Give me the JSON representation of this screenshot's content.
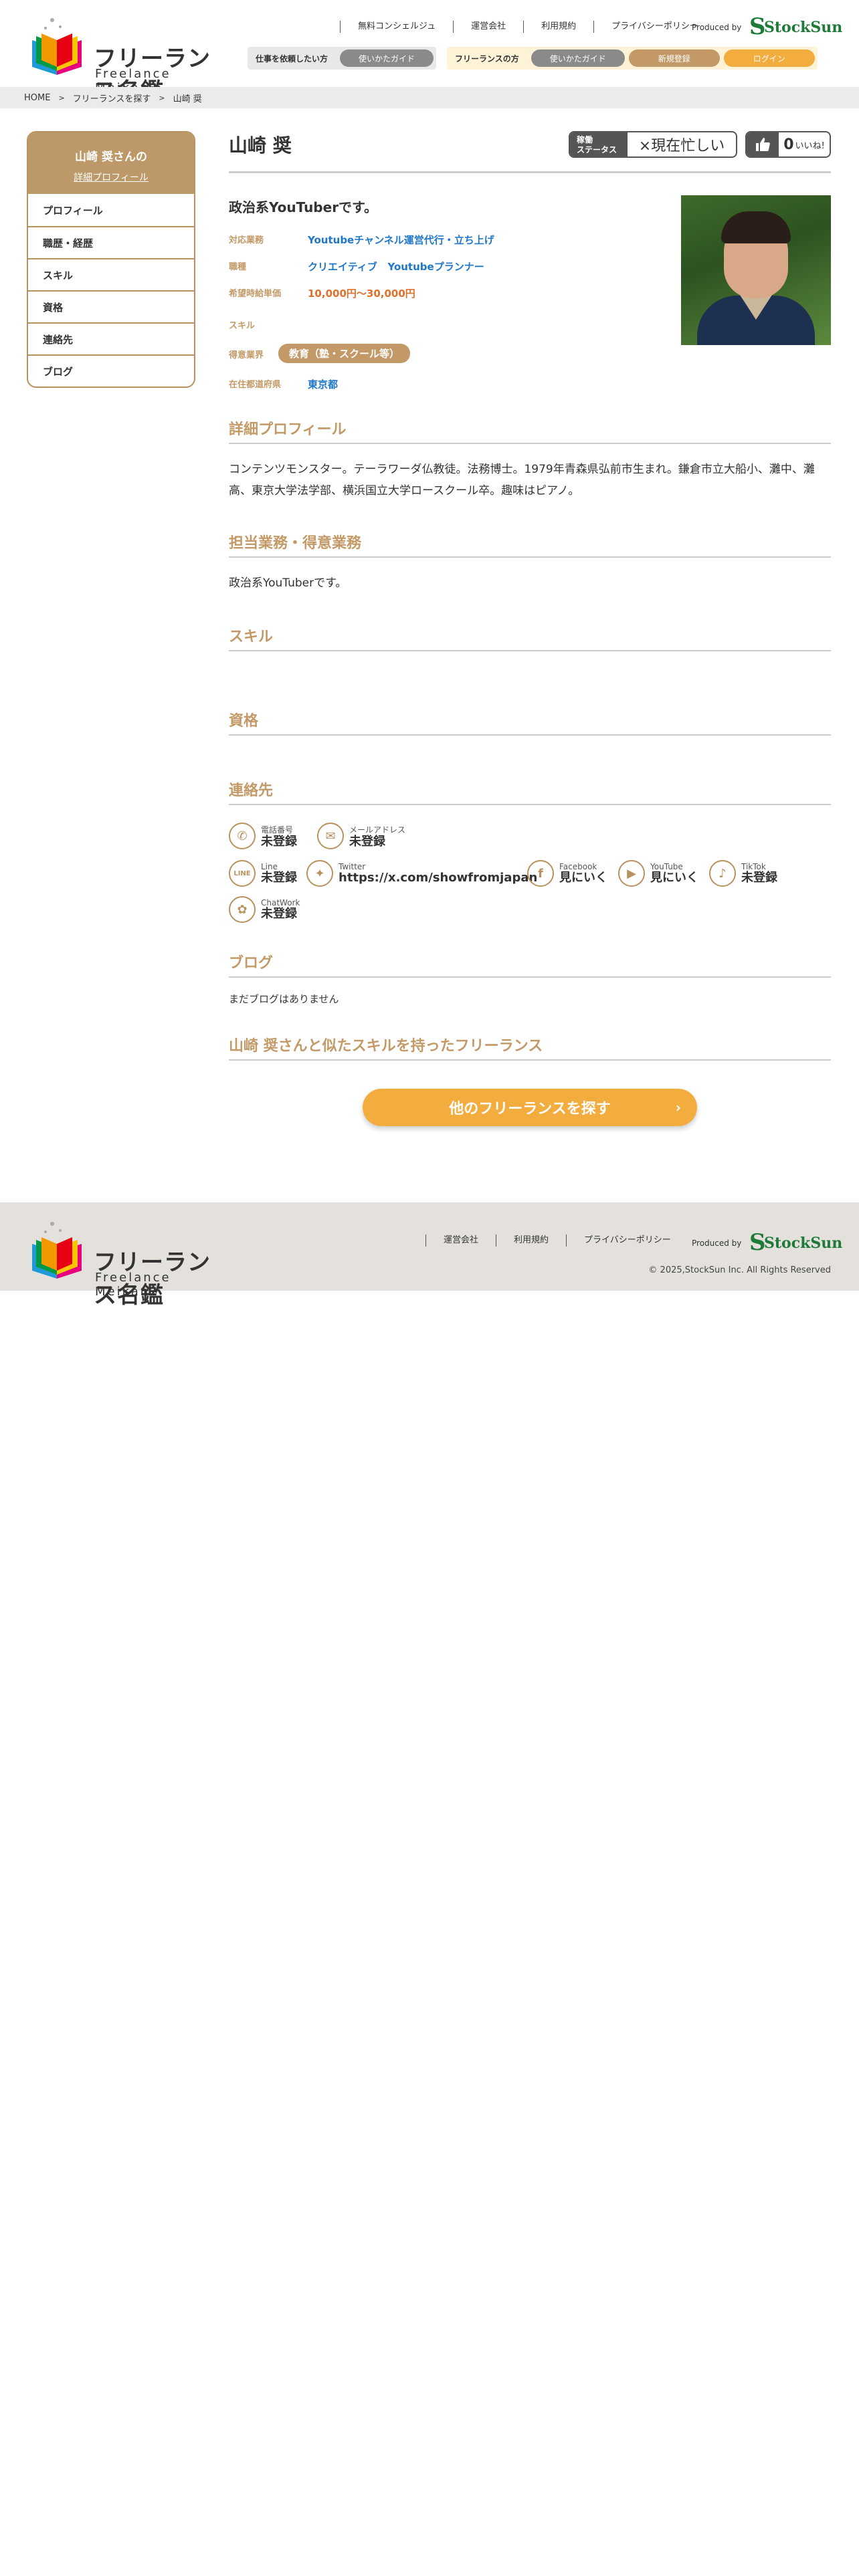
{
  "header": {
    "logo_jp": "フリーランス名鑑",
    "logo_en": "Freelance Meikan",
    "nav": [
      "無料コンシェルジュ",
      "運営会社",
      "利用規約",
      "プライバシーポリシー"
    ],
    "produced_by": "Produced by",
    "brand": "StockSun",
    "client_group_label": "仕事を依頼したい方",
    "client_guide": "使いかたガイド",
    "freelance_group_label": "フリーランスの方",
    "freelance_guide": "使いかたガイド",
    "register": "新規登録",
    "login": "ログイン"
  },
  "breadcrumb": [
    "HOME",
    "フリーランスを探す",
    "山崎 奨"
  ],
  "sidebar": {
    "title": "山崎 奨さんの",
    "subtitle": "詳細プロフィール",
    "items": [
      "プロフィール",
      "職歴・経歴",
      "スキル",
      "資格",
      "連絡先",
      "ブログ"
    ]
  },
  "profile": {
    "name": "山崎 奨",
    "status_label_1": "稼働",
    "status_label_2": "ステータス",
    "status_value": "×現在忙しい",
    "likes_count": "0",
    "likes_label": "いいね!",
    "catchphrase": "政治系YouTuberです。",
    "fields": {
      "services_label": "対応業務",
      "services_value": "Youtubeチャンネル運営代行・立ち上げ",
      "job_label": "職種",
      "job_value": "クリエイティブ   Youtubeプランナー",
      "rate_label": "希望時給単価",
      "rate_value": "10,000円〜30,000円",
      "skill_label": "スキル",
      "industry_label": "得意業界",
      "industry_value": "教育（塾・スクール等）",
      "pref_label": "在住都道府県",
      "pref_value": "東京都"
    }
  },
  "sections": {
    "detail_title": "詳細プロフィール",
    "detail_text": "コンテンツモンスター。テーラワーダ仏教徒。法務博士。1979年青森県弘前市生まれ。鎌倉市立大船小、灘中、灘高、東京大学法学部、横浜国立大学ロースクール卒。趣味はピアノ。",
    "work_title": "担当業務・得意業務",
    "work_text": "政治系YouTuberです。",
    "skill_title": "スキル",
    "cert_title": "資格",
    "contact_title": "連絡先",
    "blog_title": "ブログ",
    "blog_text": "まだブログはありません",
    "similar_title": "山崎 奨さんと似たスキルを持ったフリーランス",
    "cta": "他のフリーランスを探す"
  },
  "contacts": [
    {
      "label": "電話番号",
      "value": "未登録",
      "icon": "phone-icon"
    },
    {
      "label": "メールアドレス",
      "value": "未登録",
      "icon": "mail-icon"
    },
    {
      "label": "Line",
      "value": "未登録",
      "icon": "line-icon"
    },
    {
      "label": "Twitter",
      "value": "https://x.com/showfromjapan",
      "icon": "twitter-icon"
    },
    {
      "label": "Facebook",
      "value": "見にいく",
      "icon": "facebook-icon"
    },
    {
      "label": "YouTube",
      "value": "見にいく",
      "icon": "youtube-icon"
    },
    {
      "label": "TikTok",
      "value": "未登録",
      "icon": "tiktok-icon"
    },
    {
      "label": "ChatWork",
      "value": "未登録",
      "icon": "chatwork-icon"
    }
  ],
  "footer": {
    "nav": [
      "運営会社",
      "利用規約",
      "プライバシーポリシー"
    ],
    "produced_by": "Produced by",
    "copyright": "© 2025,StockSun Inc. All Rights Reserved"
  },
  "colors": {
    "accent_brown": "#c39a67",
    "accent_orange": "#f3ad3f",
    "link_blue": "#1f77c9",
    "rate_orange": "#e0702a",
    "brand_green": "#1f7a3a"
  }
}
